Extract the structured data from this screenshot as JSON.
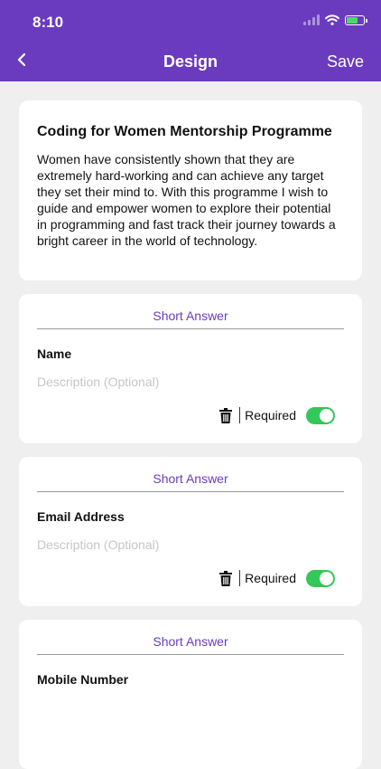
{
  "status": {
    "time": "8:10"
  },
  "nav": {
    "title": "Design",
    "save_label": "Save"
  },
  "intro": {
    "title": "Coding for Women Mentorship Programme",
    "body": "Women have consistently shown that they are extremely hard-working and can achieve any target they set their mind to. With this programme I wish to guide and empower women to explore their potential in programming and fast track their journey towards a bright career in the world of technology."
  },
  "questions": [
    {
      "type": "Short Answer",
      "title": "Name",
      "description_placeholder": "Description (Optional)",
      "required_label": "Required",
      "required": true
    },
    {
      "type": "Short Answer",
      "title": "Email Address",
      "description_placeholder": "Description (Optional)",
      "required_label": "Required",
      "required": true
    },
    {
      "type": "Short Answer",
      "title": "Mobile Number"
    }
  ],
  "colors": {
    "header": "#6a3bbf",
    "accent": "#6a3bbf",
    "toggle_on": "#34c759",
    "background": "#efefef"
  },
  "icons": {
    "back": "chevron-left-icon",
    "delete": "trash-icon",
    "wifi": "wifi-icon",
    "battery": "battery-charging-icon",
    "signal": "signal-icon"
  }
}
